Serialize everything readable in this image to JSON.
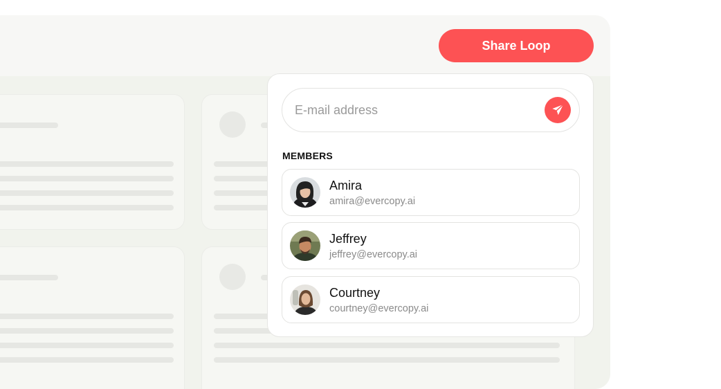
{
  "header": {
    "share_button_label": "Share Loop"
  },
  "share_panel": {
    "email_placeholder": "E-mail address",
    "email_value": "",
    "send_icon": "paper-plane-icon",
    "members_heading": "MEMBERS",
    "members": [
      {
        "name": "Amira",
        "email": "amira@evercopy.ai"
      },
      {
        "name": "Jeffrey",
        "email": "jeffrey@evercopy.ai"
      },
      {
        "name": "Courtney",
        "email": "courtney@evercopy.ai"
      }
    ]
  },
  "colors": {
    "accent": "#fd5254",
    "window_bg": "#f7f7f5",
    "content_bg": "#f1f3ed",
    "panel_bg": "#ffffff"
  }
}
